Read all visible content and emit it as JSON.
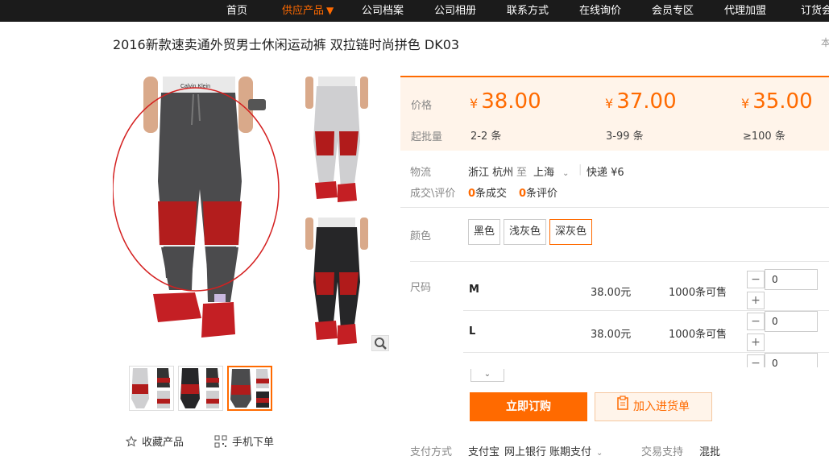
{
  "nav": {
    "items": [
      "首页",
      "供应产品",
      "公司档案",
      "公司相册",
      "联系方式",
      "在线询价",
      "会员专区",
      "代理加盟",
      "订货会"
    ],
    "active_caret": "▼"
  },
  "product": {
    "title": "2016新款速卖通外贸男士休闲运动裤 双拉链时尚拼色 DK03",
    "corner_text": "本"
  },
  "price": {
    "price_label": "价格",
    "qty_label": "起批量",
    "currency": "¥",
    "tiers": [
      {
        "price": "38.00",
        "qty": "2-2 条"
      },
      {
        "price": "37.00",
        "qty": "3-99 条"
      },
      {
        "price": "35.00",
        "qty": "≥100 条"
      }
    ]
  },
  "logistics": {
    "label": "物流",
    "from": "浙江 杭州",
    "to_word": "至",
    "dest": "上海",
    "express": "快递 ¥6"
  },
  "deals": {
    "label": "成交\\评价",
    "count": "0",
    "count_suffix": "条成交",
    "reviews": "0",
    "reviews_suffix": "条评价"
  },
  "colors": {
    "label": "颜色",
    "options": [
      "黑色",
      "浅灰色",
      "深灰色"
    ],
    "selected": "深灰色"
  },
  "sizes": {
    "label": "尺码",
    "rows": [
      {
        "size": "M",
        "price": "38.00元",
        "stock": "1000条可售",
        "qty": "0"
      },
      {
        "size": "L",
        "price": "38.00元",
        "stock": "1000条可售",
        "qty": "0"
      },
      {
        "size": "",
        "price": "",
        "stock": "",
        "qty": "0"
      }
    ],
    "minus": "−",
    "plus": "+"
  },
  "actions": {
    "buy": "立即订购",
    "cart": "加入进货单"
  },
  "gallery": {
    "favorite": "收藏产品",
    "mobile": "手机下单"
  },
  "payment": {
    "label": "支付方式",
    "methods": [
      "支付宝",
      "网上银行",
      "账期支付"
    ],
    "trade_label": "交易支持",
    "trade_value": "混批"
  },
  "colors_theme": {
    "accent": "#ff6a00",
    "nav_bg": "#1b1b1b",
    "price_bg": "#fff4ea"
  }
}
